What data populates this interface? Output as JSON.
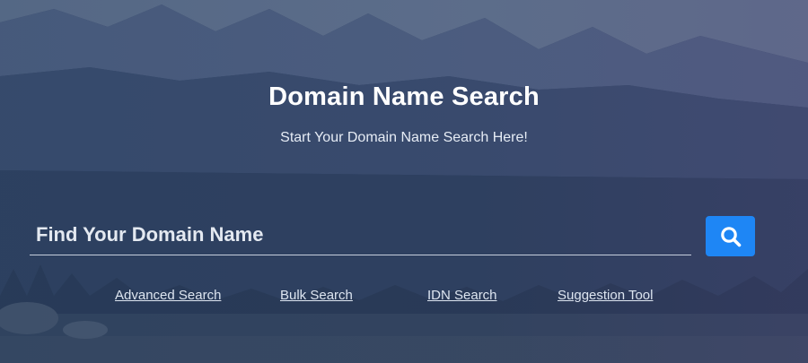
{
  "hero": {
    "title": "Domain Name Search",
    "subtitle": "Start Your Domain Name Search Here!"
  },
  "search": {
    "placeholder": "Find Your Domain Name",
    "value": "",
    "button_icon": "search-icon"
  },
  "links": [
    {
      "label": "Advanced Search"
    },
    {
      "label": "Bulk Search"
    },
    {
      "label": "IDN Search"
    },
    {
      "label": "Suggestion Tool"
    }
  ],
  "colors": {
    "background": "#2e4262",
    "accent": "#1e86f5",
    "text": "#ffffff",
    "link": "#dde5f0"
  }
}
